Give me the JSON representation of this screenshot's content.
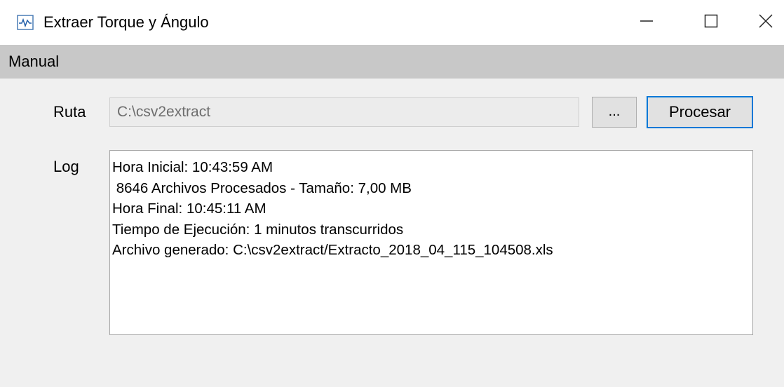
{
  "window": {
    "title": "Extraer Torque y Ángulo",
    "icon": "waveform-app-icon",
    "controls": [
      "minimize-icon",
      "maximize-icon",
      "close-icon"
    ]
  },
  "menu": {
    "items": [
      {
        "label": "Manual"
      }
    ]
  },
  "form": {
    "ruta_label": "Ruta",
    "ruta_value": "C:\\csv2extract",
    "browse_label": "...",
    "process_label": "Procesar",
    "log_label": "Log"
  },
  "log": {
    "lines": [
      "Hora Inicial: 10:43:59 AM",
      " 8646 Archivos Procesados - Tamaño: 7,00 MB",
      "Hora Final: 10:45:11 AM",
      "Tiempo de Ejecución: 1 minutos transcurridos",
      "Archivo generado: C:\\csv2extract/Extracto_2018_04_115_104508.xls"
    ]
  },
  "colors": {
    "focus_border": "#0078d7",
    "menubar_bg": "#c8c8c8",
    "window_bg": "#f0f0f0"
  }
}
